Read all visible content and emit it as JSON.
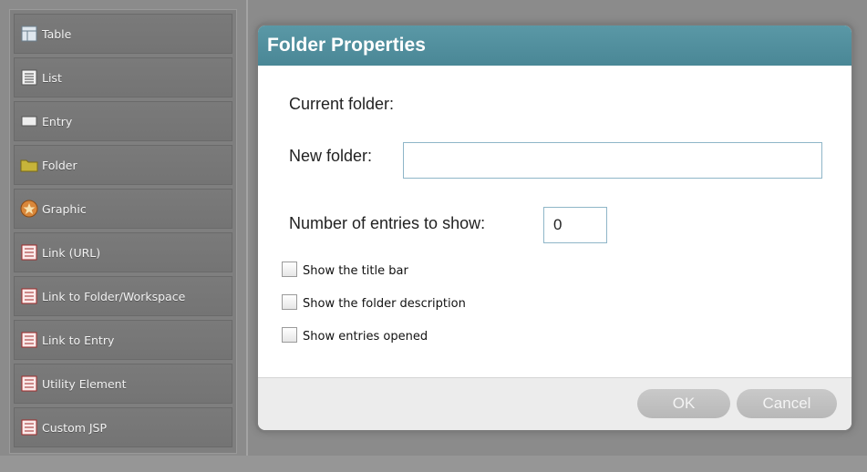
{
  "palette": {
    "items": [
      {
        "label": "Table",
        "icon": "table-icon"
      },
      {
        "label": "List",
        "icon": "list-icon"
      },
      {
        "label": "Entry",
        "icon": "entry-icon"
      },
      {
        "label": "Folder",
        "icon": "folder-icon"
      },
      {
        "label": "Graphic",
        "icon": "graphic-icon"
      },
      {
        "label": "Link (URL)",
        "icon": "link-icon"
      },
      {
        "label": "Link to Folder/Workspace",
        "icon": "link-icon"
      },
      {
        "label": "Link to Entry",
        "icon": "link-icon"
      },
      {
        "label": "Utility Element",
        "icon": "link-icon"
      },
      {
        "label": "Custom JSP",
        "icon": "link-icon"
      }
    ]
  },
  "dialog": {
    "title": "Folder Properties",
    "current_folder_label": "Current folder:",
    "new_folder_label": "New folder:",
    "new_folder_value": "",
    "entries_label": "Number of entries to show:",
    "entries_value": "0",
    "checkboxes": [
      {
        "label": "Show the title bar",
        "checked": false
      },
      {
        "label": "Show the folder description",
        "checked": false
      },
      {
        "label": "Show entries opened",
        "checked": false
      }
    ],
    "ok_label": "OK",
    "cancel_label": "Cancel"
  },
  "colors": {
    "title_bar": "#5a98a6",
    "input_border": "#8fb6c8",
    "button": "#c0c0c0"
  }
}
